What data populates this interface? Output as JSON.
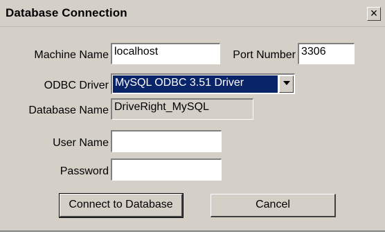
{
  "dialog": {
    "title": "Database Connection",
    "close_glyph": "×"
  },
  "form": {
    "machine_name": {
      "label": "Machine Name",
      "value": "localhost"
    },
    "port_number": {
      "label": "Port Number",
      "value": "3306"
    },
    "odbc_driver": {
      "label": "ODBC Driver",
      "value": "MySQL ODBC 3.51 Driver"
    },
    "database_name": {
      "label": "Database Name",
      "value": "DriveRight_MySQL"
    },
    "user_name": {
      "label": "User Name",
      "value": ""
    },
    "password": {
      "label": "Password",
      "value": ""
    }
  },
  "buttons": {
    "connect": "Connect to Database",
    "cancel": "Cancel"
  },
  "icons": {
    "close": "close-icon",
    "dropdown": "chevron-down-icon"
  },
  "colors": {
    "dialog_bg": "#d4d0c8",
    "selection_bg": "#0a246a"
  }
}
